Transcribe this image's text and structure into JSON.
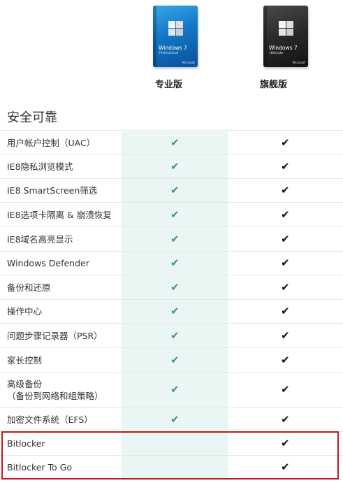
{
  "products": [
    {
      "box_title": "Windows 7",
      "box_edition": "Professional",
      "box_brand": "Microsoft",
      "label": "专业版"
    },
    {
      "box_title": "Windows 7",
      "box_edition": "Ultimate",
      "box_brand": "Microsoft",
      "label": "旗舰版"
    }
  ],
  "section_title": "安全可靠",
  "colors": {
    "check_pro": "#3d8f86",
    "check_ult": "#111111",
    "pro_column_bg": "#eaf6f3",
    "highlight_border": "#c0191f"
  },
  "features": [
    {
      "label": "用户帐户控制（UAC）",
      "pro": true,
      "ult": true
    },
    {
      "label": "IE8隐私浏览模式",
      "pro": true,
      "ult": true
    },
    {
      "label": "IE8 SmartScreen筛选",
      "pro": true,
      "ult": true
    },
    {
      "label": "IE8选项卡隔离 & 崩溃恢复",
      "pro": true,
      "ult": true
    },
    {
      "label": "IE8域名高亮显示",
      "pro": true,
      "ult": true
    },
    {
      "label": "Windows Defender",
      "pro": true,
      "ult": true
    },
    {
      "label": "备份和还原",
      "pro": true,
      "ult": true
    },
    {
      "label": "操作中心",
      "pro": true,
      "ult": true
    },
    {
      "label": "问题步骤记录器（PSR）",
      "pro": true,
      "ult": true
    },
    {
      "label": "家长控制",
      "pro": true,
      "ult": true
    },
    {
      "label": "高级备份\n（备份到网络和组策略）",
      "pro": true,
      "ult": true
    },
    {
      "label": "加密文件系统（EFS）",
      "pro": true,
      "ult": true
    },
    {
      "label": "Bitlocker",
      "pro": false,
      "ult": true
    },
    {
      "label": "Bitlocker To Go",
      "pro": false,
      "ult": true
    }
  ],
  "check_glyph": "✔"
}
